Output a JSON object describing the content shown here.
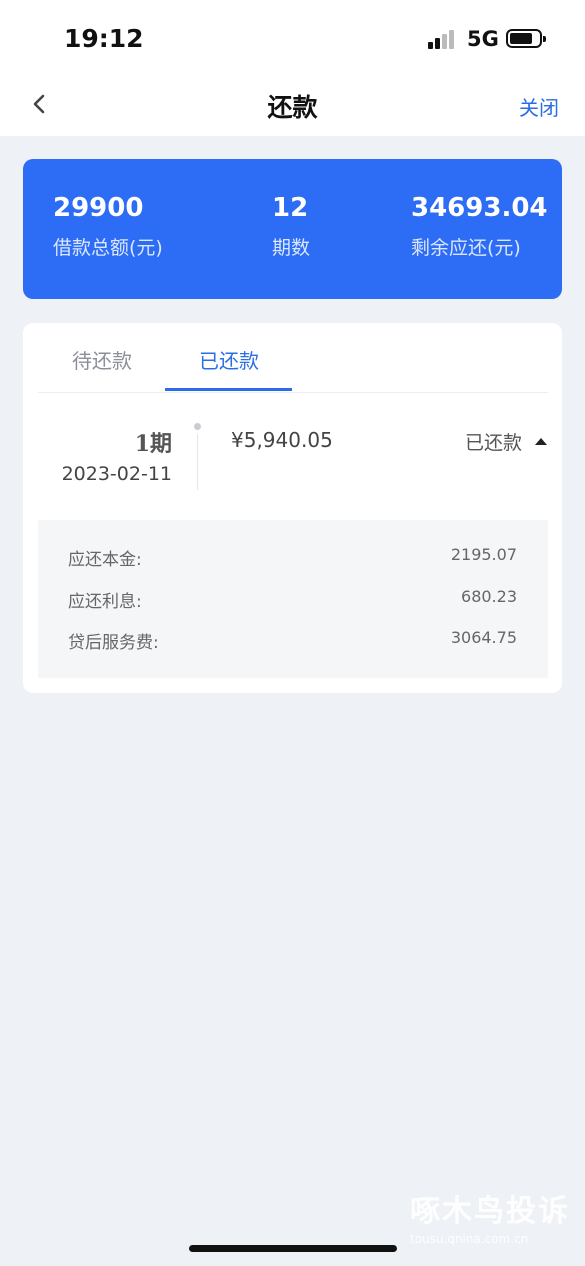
{
  "status_bar": {
    "time": "19:12",
    "network": "5G"
  },
  "nav": {
    "title": "还款",
    "close_label": "关闭"
  },
  "summary": {
    "loan_total_value": "29900",
    "loan_total_label": "借款总额(元)",
    "periods_value": "12",
    "periods_label": "期数",
    "remaining_value": "34693.04",
    "remaining_label": "剩余应还(元)"
  },
  "tabs": {
    "pending": "待还款",
    "paid": "已还款"
  },
  "records": [
    {
      "period": "1期",
      "date": "2023-02-11",
      "amount": "¥5,940.05",
      "status": "已还款",
      "details": [
        {
          "label": "应还本金:",
          "value": "2195.07"
        },
        {
          "label": "应还利息:",
          "value": "680.23"
        },
        {
          "label": "贷后服务费:",
          "value": "3064.75"
        }
      ]
    }
  ],
  "watermark": {
    "main": "啄木鸟投诉",
    "sub": "tousu.qnina.com.cn"
  },
  "colors": {
    "accent": "#2a6de6",
    "card_blue": "#2d6df6",
    "background": "#eef1f6"
  }
}
